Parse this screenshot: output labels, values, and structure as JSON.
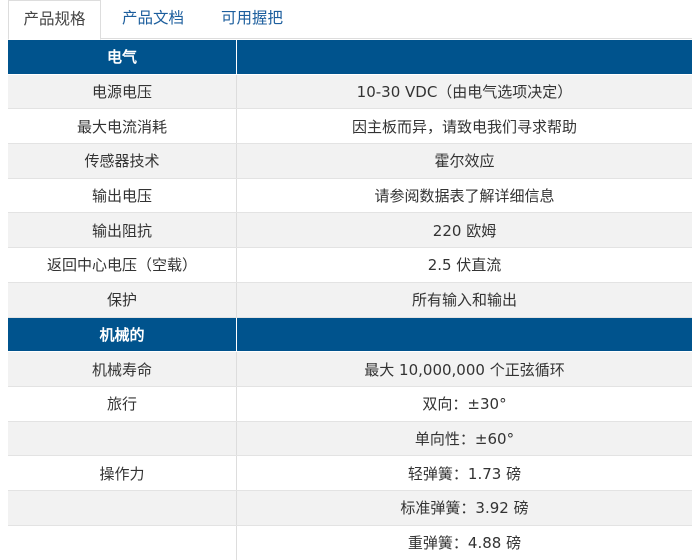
{
  "tabs": [
    "产品规格",
    "产品文档",
    "可用握把"
  ],
  "sections": {
    "electrical": {
      "title": "电气",
      "rows": [
        {
          "label": "电源电压",
          "value": "10-30 VDC（由电气选项决定）"
        },
        {
          "label": "最大电流消耗",
          "value": "因主板而异，请致电我们寻求帮助"
        },
        {
          "label": "传感器技术",
          "value": "霍尔效应"
        },
        {
          "label": "输出电压",
          "value": "请参阅数据表了解详细信息"
        },
        {
          "label": "输出阻抗",
          "value": "220 欧姆"
        },
        {
          "label": "返回中心电压（空载）",
          "value": "2.5 伏直流"
        },
        {
          "label": "保护",
          "value": "所有输入和输出"
        }
      ]
    },
    "mechanical": {
      "title": "机械的",
      "life": {
        "label": "机械寿命",
        "value": "最大 10,000,000 个正弦循环"
      },
      "travel": {
        "label": "旅行",
        "values": [
          "双向：±30°",
          "单向性：±60°"
        ]
      },
      "force": {
        "label": "操作力",
        "values": [
          "轻弹簧：1.73 磅",
          "标准弹簧：3.92 磅",
          "重弹簧：4.88 磅"
        ]
      }
    }
  }
}
